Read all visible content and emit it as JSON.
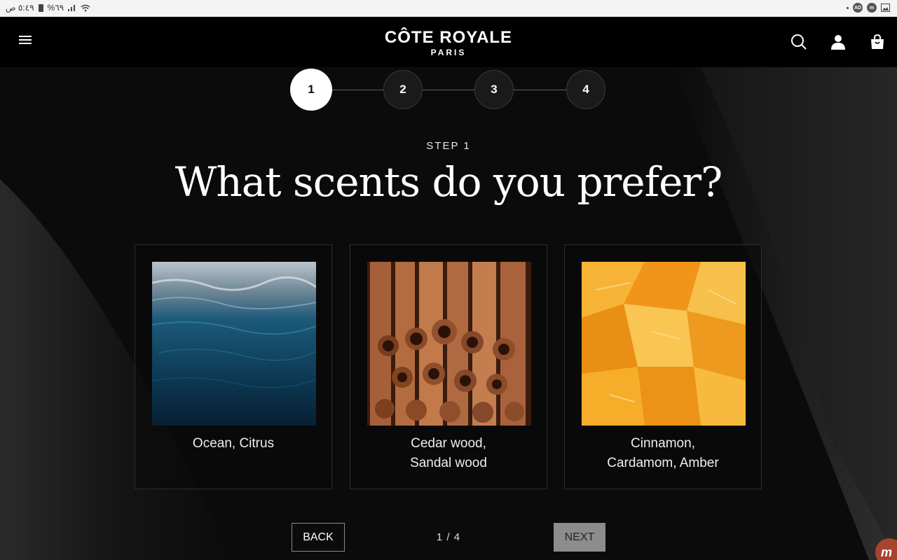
{
  "statusbar": {
    "time": "٥:٤٩ ص",
    "battery": "%٦٩"
  },
  "header": {
    "logo_main": "CÔTE ROYALE",
    "logo_sub": "PARIS"
  },
  "stepper": {
    "steps": [
      "1",
      "2",
      "3",
      "4"
    ],
    "active_step": 1
  },
  "content": {
    "step_label": "STEP 1",
    "question": "What scents do you prefer?",
    "options": [
      {
        "label_line1": "Ocean, Citrus",
        "label_line2": ""
      },
      {
        "label_line1": "Cedar wood,",
        "label_line2": "Sandal wood"
      },
      {
        "label_line1": "Cinnamon,",
        "label_line2": "Cardamom, Amber"
      }
    ]
  },
  "nav": {
    "back_label": "BACK",
    "next_label": "NEXT",
    "pager": "1 / 4"
  },
  "colors": {
    "background": "#0b0b0b",
    "header": "#000000",
    "active_step": "#ffffff",
    "next_button": "#8c8c8c"
  }
}
